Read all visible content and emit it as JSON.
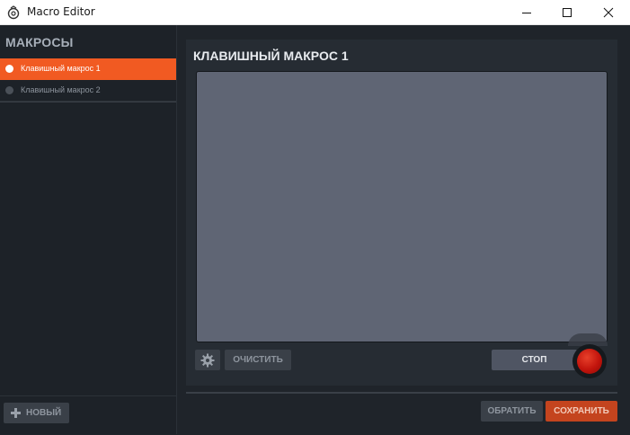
{
  "window": {
    "title": "Macro Editor",
    "controls": [
      "minimize-icon",
      "maximize-icon",
      "close-icon"
    ]
  },
  "sidebar": {
    "header": "МАКРОСЫ",
    "items": [
      {
        "label": "Клавишный макрос 1",
        "selected": true
      },
      {
        "label": "Клавишный макрос 2",
        "selected": false
      }
    ],
    "new_button": "НОВЫЙ"
  },
  "main": {
    "title": "КЛАВИШНЫЙ МАКРОС 1",
    "settings_icon": "gear-icon",
    "clear_button": "ОЧИСТИТЬ",
    "stop_button": "СТОП",
    "record_icon": "record-icon"
  },
  "footer": {
    "revert_button": "ОБРАТИТЬ",
    "save_button": "СОХРАНИТЬ"
  },
  "colors": {
    "accent": "#f15a22",
    "save": "#c4441e",
    "editor_bg": "#5f6574",
    "record": "#c2140c"
  }
}
